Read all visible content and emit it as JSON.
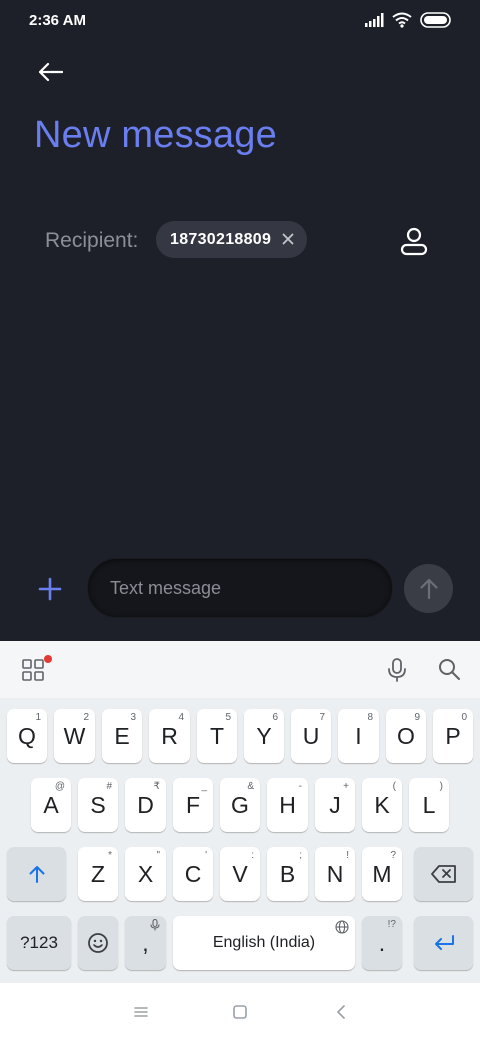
{
  "status_bar": {
    "time": "2:36 AM"
  },
  "header": {
    "title": "New message"
  },
  "recipient": {
    "label": "Recipient:",
    "chip_text": "18730218809"
  },
  "composer": {
    "placeholder": "Text message"
  },
  "keyboard": {
    "row1": [
      {
        "label": "Q",
        "hint": "1"
      },
      {
        "label": "W",
        "hint": "2"
      },
      {
        "label": "E",
        "hint": "3"
      },
      {
        "label": "R",
        "hint": "4"
      },
      {
        "label": "T",
        "hint": "5"
      },
      {
        "label": "Y",
        "hint": "6"
      },
      {
        "label": "U",
        "hint": "7"
      },
      {
        "label": "I",
        "hint": "8"
      },
      {
        "label": "O",
        "hint": "9"
      },
      {
        "label": "P",
        "hint": "0"
      }
    ],
    "row2": [
      {
        "label": "A",
        "hint": "@"
      },
      {
        "label": "S",
        "hint": "#"
      },
      {
        "label": "D",
        "hint": "₹"
      },
      {
        "label": "F",
        "hint": "_"
      },
      {
        "label": "G",
        "hint": "&"
      },
      {
        "label": "H",
        "hint": "-"
      },
      {
        "label": "J",
        "hint": "+"
      },
      {
        "label": "K",
        "hint": "("
      },
      {
        "label": "L",
        "hint": ")"
      }
    ],
    "row3": [
      {
        "label": "Z",
        "hint": "*"
      },
      {
        "label": "X",
        "hint": "\""
      },
      {
        "label": "C",
        "hint": "'"
      },
      {
        "label": "V",
        "hint": ":"
      },
      {
        "label": "B",
        "hint": ";"
      },
      {
        "label": "N",
        "hint": "!"
      },
      {
        "label": "M",
        "hint": "?"
      }
    ],
    "symbols_label": "?123",
    "comma_label": ",",
    "space_label": "English (India)",
    "period_label": ".",
    "period_hint": "!?"
  },
  "colors": {
    "accent": "#6a7ef0",
    "background": "#1e2029",
    "keyboard_bg": "#eceff1"
  }
}
